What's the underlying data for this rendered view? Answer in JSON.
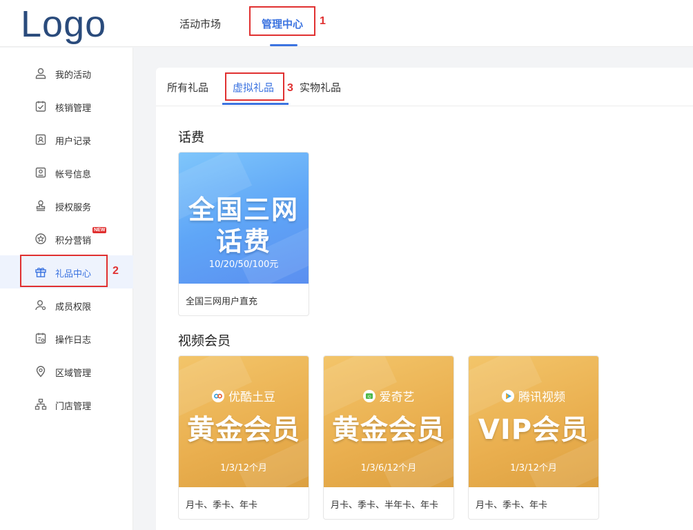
{
  "header": {
    "logo": "Logo",
    "nav": [
      {
        "label": "活动市场"
      },
      {
        "label": "管理中心"
      }
    ],
    "annotations": [
      "1",
      "2",
      "3"
    ]
  },
  "sidebar": {
    "items": [
      {
        "label": "我的活动",
        "icon": "user-icon"
      },
      {
        "label": "核销管理",
        "icon": "clipboard-check-icon"
      },
      {
        "label": "用户记录",
        "icon": "contact-card-icon"
      },
      {
        "label": "帐号信息",
        "icon": "id-card-icon"
      },
      {
        "label": "授权服务",
        "icon": "stamp-icon"
      },
      {
        "label": "积分营销",
        "icon": "star-circle-icon",
        "badge": "NEW"
      },
      {
        "label": "礼品中心",
        "icon": "gift-icon"
      },
      {
        "label": "成员权限",
        "icon": "user-settings-icon"
      },
      {
        "label": "操作日志",
        "icon": "calendar-log-icon"
      },
      {
        "label": "区域管理",
        "icon": "location-pin-icon"
      },
      {
        "label": "门店管理",
        "icon": "org-chart-icon"
      }
    ]
  },
  "tabs": [
    {
      "label": "所有礼品"
    },
    {
      "label": "虚拟礼品"
    },
    {
      "label": "实物礼品"
    }
  ],
  "sections": [
    {
      "title": "话费",
      "gifts": [
        {
          "line1": "全国三网",
          "line2": "话费",
          "sub": "10/20/50/100元",
          "caption": "全国三网用户直充"
        }
      ]
    },
    {
      "title": "视频会员",
      "gifts": [
        {
          "brand": "优酷土豆",
          "big": "黄金会员",
          "sub": "1/3/12个月",
          "caption": "月卡、季卡、年卡"
        },
        {
          "brand": "爱奇艺",
          "big": "黄金会员",
          "sub": "1/3/6/12个月",
          "caption": "月卡、季卡、半年卡、年卡"
        },
        {
          "brand": "腾讯视频",
          "big": "VIP会员",
          "sub": "1/3/12个月",
          "caption": "月卡、季卡、年卡"
        }
      ]
    }
  ],
  "colors": {
    "accent": "#3b73e0",
    "annotation": "#e03030",
    "logo": "#2a4b7c"
  }
}
